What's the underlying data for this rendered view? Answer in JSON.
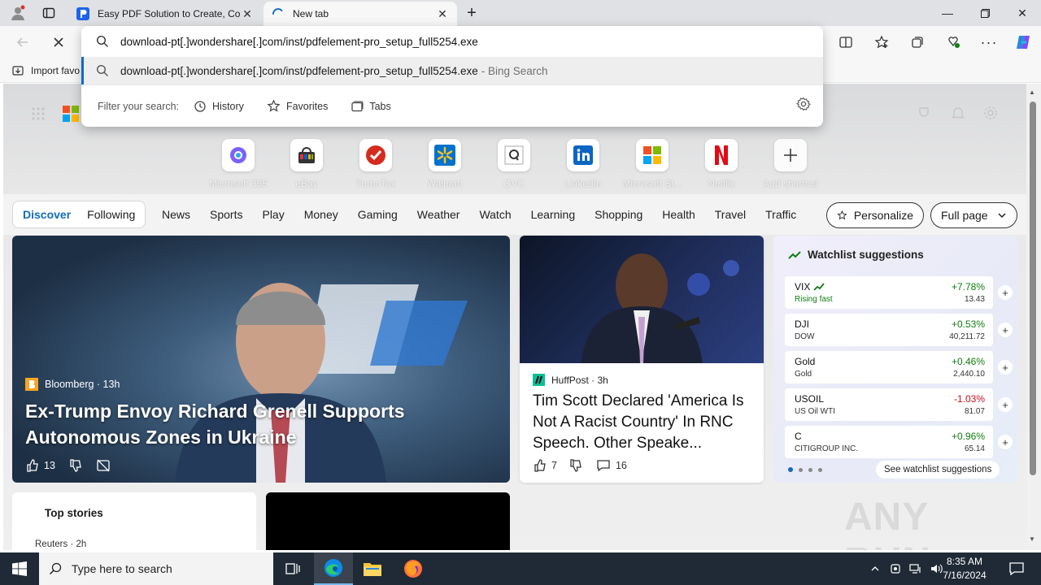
{
  "tabs": [
    {
      "title": "Easy PDF Solution to Create, Con",
      "active": false
    },
    {
      "title": "New tab",
      "active": true
    }
  ],
  "omnibox": {
    "input_value": "download-pt[.]wondershare[.]com/inst/pdfelement-pro_setup_full5254.exe",
    "suggestion_text": "download-pt[.]wondershare[.]com/inst/pdfelement-pro_setup_full5254.exe",
    "suggestion_suffix": "- Bing Search",
    "filter_label": "Filter your search:",
    "filters": [
      "History",
      "Favorites",
      "Tabs"
    ]
  },
  "favorites_bar": {
    "import_label": "Import favo"
  },
  "shortcuts": [
    "Microsoft 365",
    "eBay",
    "TurboTax",
    "Walmart",
    "QVC",
    "LinkedIn",
    "Microsoft St...",
    "Netflix",
    "Add shortcut"
  ],
  "feed_nav": {
    "pill": [
      "Discover",
      "Following"
    ],
    "links": [
      "News",
      "Sports",
      "Play",
      "Money",
      "Gaming",
      "Weather",
      "Watch",
      "Learning",
      "Shopping",
      "Health",
      "Travel",
      "Traffic"
    ],
    "personalize": "Personalize",
    "full_page": "Full page"
  },
  "hero": {
    "source": "Bloomberg · 13h",
    "headline": "Ex-Trump Envoy Richard Grenell Supports Autonomous Zones in Ukraine",
    "likes": "13"
  },
  "card2": {
    "source": "HuffPost · 3h",
    "headline": "Tim Scott Declared 'America Is Not A Racist Country' In RNC Speech. Other Speake...",
    "likes": "7",
    "comments": "16"
  },
  "watchlist": {
    "title": "Watchlist suggestions",
    "rows": [
      {
        "symbol": "VIX",
        "sub": "Rising fast",
        "change": "+7.78%",
        "price": "13.43",
        "dir": "up"
      },
      {
        "symbol": "DJI",
        "sub": "DOW",
        "change": "+0.53%",
        "price": "40,211.72",
        "dir": "up"
      },
      {
        "symbol": "Gold",
        "sub": "Gold",
        "change": "+0.46%",
        "price": "2,440.10",
        "dir": "up"
      },
      {
        "symbol": "USOIL",
        "sub": "US Oil WTI",
        "change": "-1.03%",
        "price": "81.07",
        "dir": "down"
      },
      {
        "symbol": "C",
        "sub": "CITIGROUP INC.",
        "change": "+0.96%",
        "price": "65.14",
        "dir": "up"
      }
    ],
    "see_more": "See watchlist suggestions"
  },
  "top_stories": {
    "title": "Top stories",
    "source": "Reuters · 2h"
  },
  "watermark": "ANY RUN",
  "taskbar": {
    "search_placeholder": "Type here to search",
    "time": "8:35 AM",
    "date": "7/16/2024"
  },
  "colors": {
    "accent": "#0f6cbd",
    "up": "#107c10",
    "down": "#c50f1f",
    "taskbar": "#1f2a36"
  }
}
